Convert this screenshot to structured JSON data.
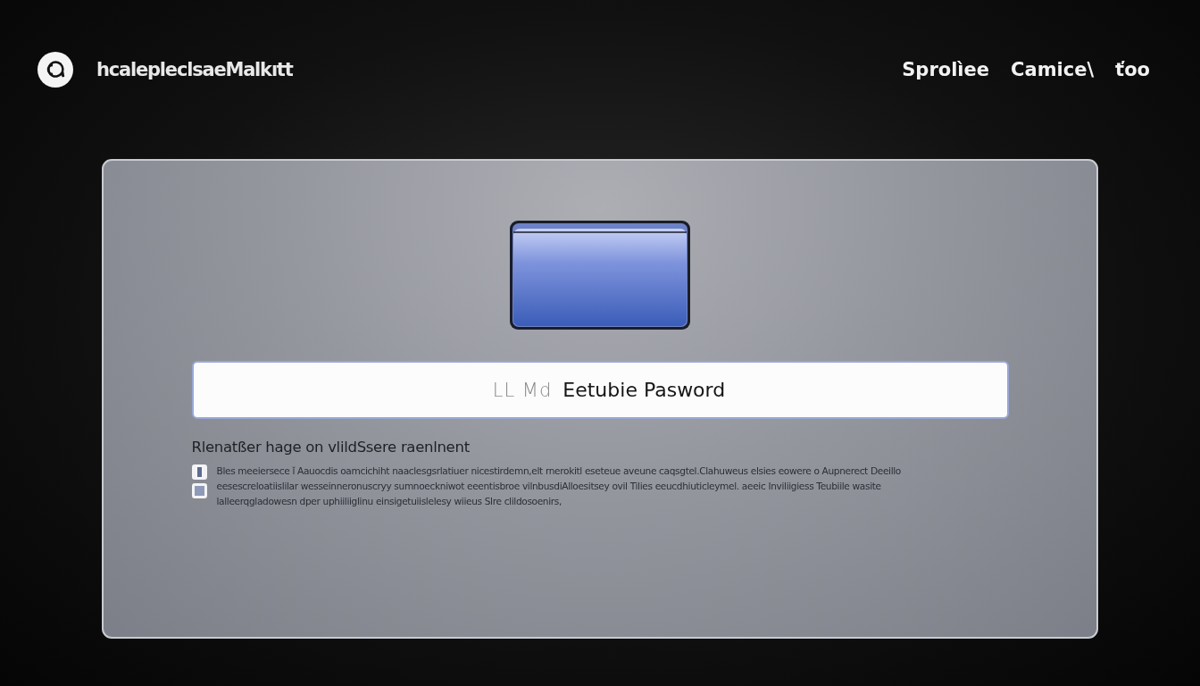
{
  "header": {
    "brand": "hcalepleclsaeMalkıtt",
    "nav": [
      {
        "label": "Sprolìee"
      },
      {
        "label": "Camice\\"
      },
      {
        "label": "ťoo"
      }
    ]
  },
  "form": {
    "field": {
      "prefix": "LL Md",
      "value": "Eetubie Pasword"
    },
    "heading": "Rlenatßer hage on vlildSsere raenlnent",
    "checkboxes": [
      {
        "checked": true
      },
      {
        "checked": false
      }
    ],
    "paragraph": "Bles meeiersece ǐ Aauocdis oamcichiht naaclesgsrlatiuer nicestirdemn,elt rnerokitl eseteue aveune caqsgtel.Clahuweus elsies eowere o Aupnerect Deeillo eesescreloatiislilar wesseinneronuscryy sumnoeckniwot eeentisbroe vilnbusdiAlloesitsey ovil Tilies eeucdhiuticleymel. aeeic Inviliigiess Teubiile wasite lalleerqgladowesn dper uphiiliiglinu einsigetuiislelesy wiieus Slre clildosoenirs,"
  }
}
